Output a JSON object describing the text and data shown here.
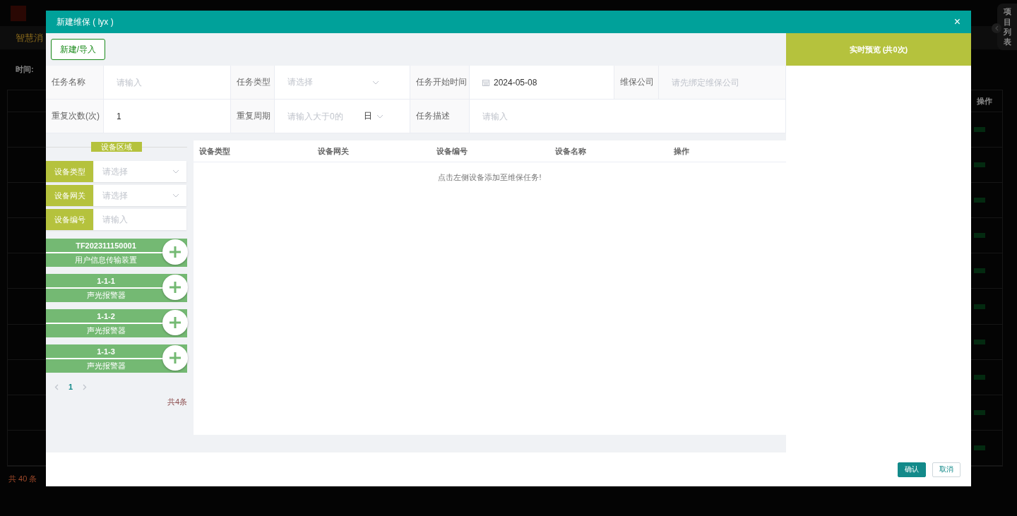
{
  "background": {
    "nav_tab": "智慧消",
    "filter_label": "时间:",
    "table_header": "操作",
    "total": "共 40 条",
    "side_tab": "项目列表"
  },
  "dialog": {
    "title": "新建维保 ( lyx )",
    "close": "×",
    "toolbar_button": "新建/导入",
    "form": [
      [
        {
          "label": "任务名称",
          "kind": "input",
          "placeholder": "请输入"
        },
        {
          "label": "任务类型",
          "kind": "select",
          "placeholder": "请选择"
        },
        {
          "label": "任务开始时间",
          "kind": "date",
          "value": "2024-05-08"
        },
        {
          "label": "维保公司",
          "kind": "locked",
          "placeholder": "请先绑定维保公司"
        }
      ],
      [
        {
          "label": "重复次数(次)",
          "kind": "input",
          "value": "1"
        },
        {
          "label": "重复周期",
          "kind": "period",
          "placeholder": "请输入大于0的",
          "unit": "日"
        },
        {
          "label": "任务描述",
          "kind": "input",
          "placeholder": "请输入",
          "wide": true
        }
      ]
    ],
    "device_area": {
      "title": "设备区域",
      "filters": [
        {
          "label": "设备类型",
          "kind": "select",
          "placeholder": "请选择"
        },
        {
          "label": "设备网关",
          "kind": "select",
          "placeholder": "请选择"
        },
        {
          "label": "设备编号",
          "kind": "input",
          "placeholder": "请输入"
        }
      ],
      "devices": [
        {
          "code": "TF202311150001",
          "name": "用户信息传输装置"
        },
        {
          "code": "1-1-1",
          "name": "声光报警器"
        },
        {
          "code": "1-1-2",
          "name": "声光报警器"
        },
        {
          "code": "1-1-3",
          "name": "声光报警器"
        }
      ],
      "pages": [
        {
          "label": "1",
          "selected": true
        }
      ],
      "total": "共4条"
    },
    "table": {
      "columns": [
        "设备类型",
        "设备网关",
        "设备编号",
        "设备名称",
        "操作"
      ],
      "empty_text": "点击左侧设备添加至维保任务!"
    },
    "preview": {
      "title": "实时预览 (共0次)"
    },
    "buttons": [
      {
        "label": "确认",
        "kind": "primary"
      },
      {
        "label": "取消",
        "kind": "secondary"
      }
    ]
  }
}
